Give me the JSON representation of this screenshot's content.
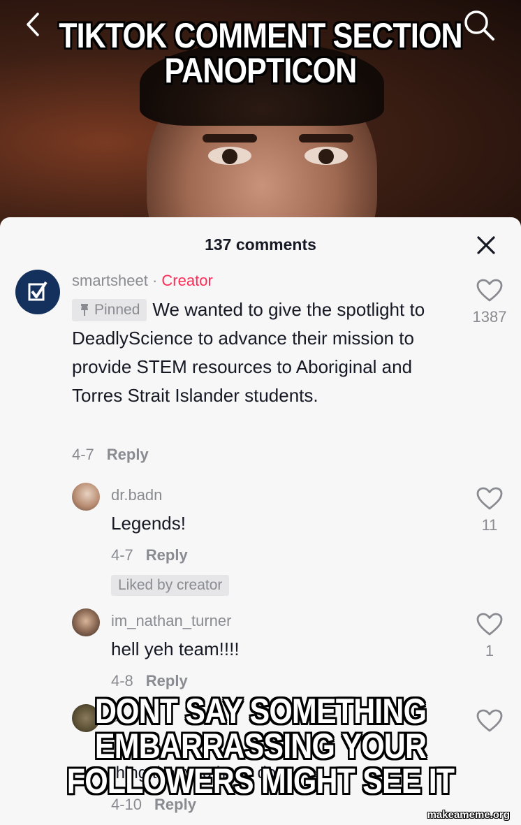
{
  "meme": {
    "top_text": "TIKTOK COMMENT SECTION PANOPTICON",
    "bottom_text": "DONT SAY SOMETHING EMBARRASSING YOUR FOLLOWERS MIGHT SEE IT"
  },
  "watermark": "makeameme.org",
  "header": {
    "comment_count": "137 comments"
  },
  "icons": {
    "back": "chevron-left-icon",
    "search": "search-icon",
    "close": "close-icon",
    "like": "heart-outline-icon",
    "pin": "pin-icon"
  },
  "colors": {
    "creator": "#fe2c55",
    "muted": "#8a8b91",
    "text": "#161823",
    "sheet_bg": "#f7f7f8",
    "brand_logo": "#13315c"
  },
  "comments": [
    {
      "username": "smartsheet",
      "separator": "·",
      "tag": "Creator",
      "pinned_label": "Pinned",
      "text": "We wanted to give the spotlight to DeadlyScience to advance their mission to provide STEM resources to Aboriginal and Torres Strait Islander students.",
      "date": "4-7",
      "reply_label": "Reply",
      "likes": "1387"
    },
    {
      "username": "dr.badn",
      "text": "Legends!",
      "date": "4-7",
      "reply_label": "Reply",
      "likes": "11",
      "badge": "Liked by creator"
    },
    {
      "username": "im_nathan_turner",
      "text": "hell yeh team!!!!",
      "date": "4-8",
      "reply_label": "Reply",
      "likes": "1"
    },
    {
      "username": "c",
      "text": "thing that you have done",
      "date": "4-10",
      "reply_label": "Reply"
    }
  ]
}
